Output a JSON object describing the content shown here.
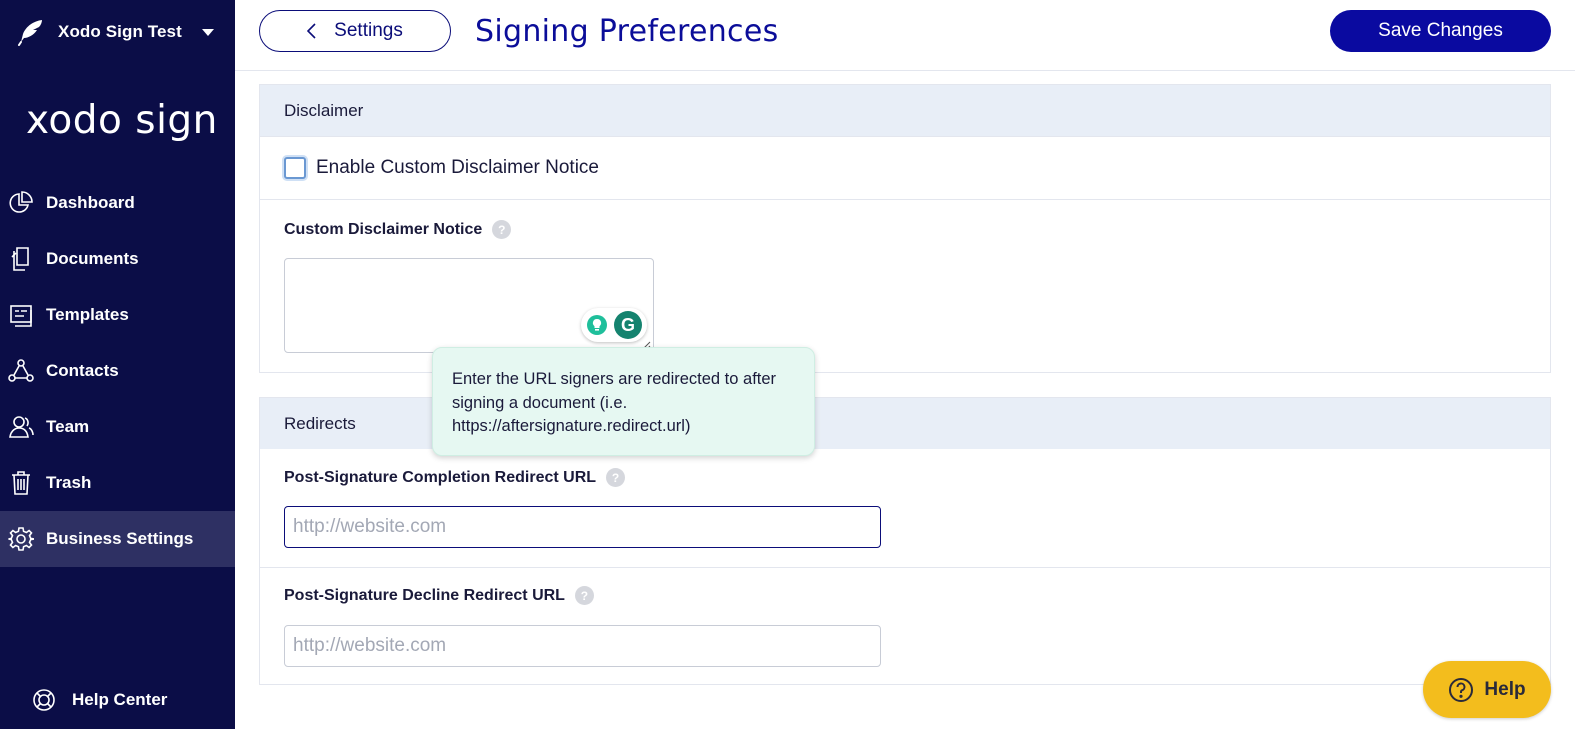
{
  "sidebar": {
    "account_name": "Xodo Sign Test",
    "brand": "xodo sign",
    "items": [
      {
        "label": "Dashboard",
        "icon": "pie-chart-icon"
      },
      {
        "label": "Documents",
        "icon": "documents-icon"
      },
      {
        "label": "Templates",
        "icon": "templates-icon"
      },
      {
        "label": "Contacts",
        "icon": "contacts-icon"
      },
      {
        "label": "Team",
        "icon": "team-icon"
      },
      {
        "label": "Trash",
        "icon": "trash-icon"
      },
      {
        "label": "Business Settings",
        "icon": "gear-icon",
        "active": true
      }
    ],
    "help_center": "Help Center"
  },
  "header": {
    "back_label": "Settings",
    "title": "Signing Preferences",
    "save_label": "Save Changes"
  },
  "disclaimer": {
    "heading": "Disclaimer",
    "enable_label": "Enable Custom Disclaimer Notice",
    "enabled": false,
    "notice_label": "Custom Disclaimer Notice",
    "notice_value": ""
  },
  "redirects": {
    "heading": "Redirects",
    "completion_label": "Post-Signature Completion Redirect URL",
    "completion_placeholder": "http://website.com",
    "decline_label": "Post-Signature Decline Redirect URL",
    "decline_placeholder": "http://website.com"
  },
  "tooltip": {
    "text": "Enter the URL signers are redirected to after signing a document (i.e. https://aftersignature.redirect.url)"
  },
  "help_button": {
    "label": "Help"
  },
  "colors": {
    "sidebar_bg": "#0b0d47",
    "accent": "#0a0aa0",
    "help_yellow": "#f3bd1d",
    "tooltip_bg": "#e6f8f2"
  }
}
